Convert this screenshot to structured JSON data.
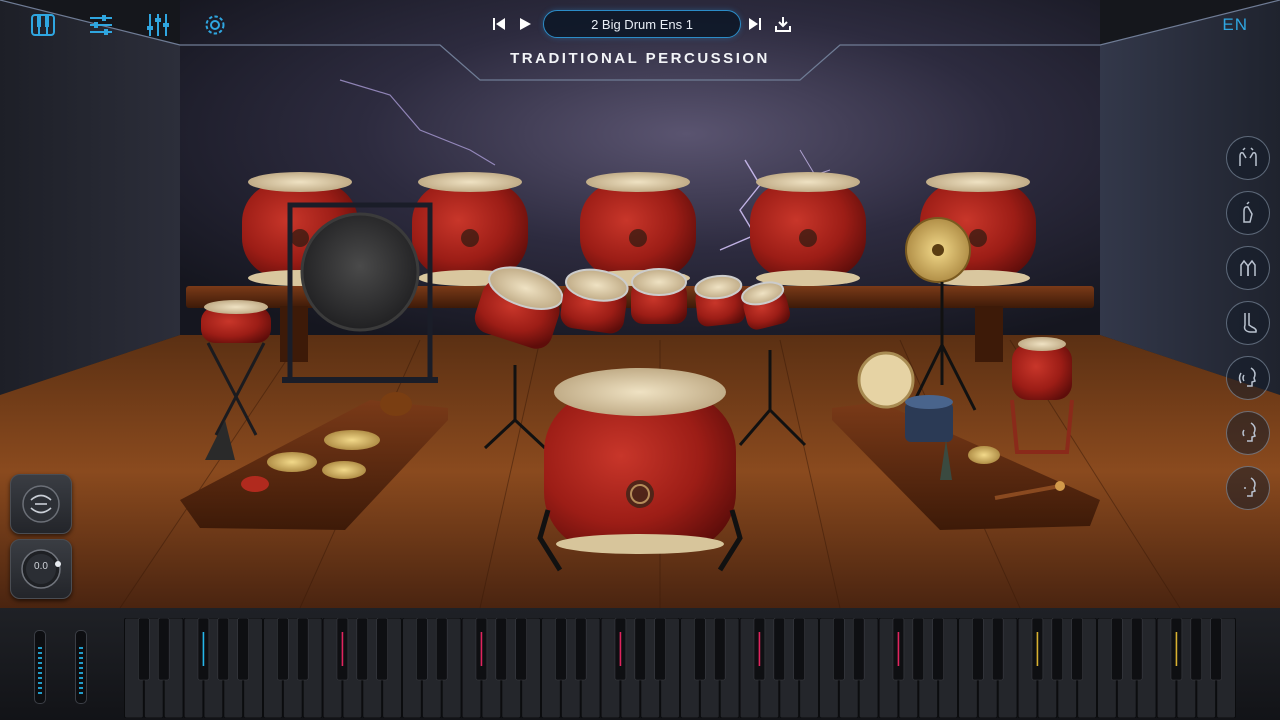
{
  "toolbar": {
    "icons": [
      "keyboard-icon",
      "mixer-icon",
      "equalizer-icon",
      "gear-icon"
    ],
    "accent_color": "#2fa6e0"
  },
  "transport": {
    "preset_name": "2 Big Drum Ens 1",
    "icons": [
      "previous-icon",
      "play-icon",
      "next-icon",
      "download-icon"
    ]
  },
  "instrument_title": "TRADITIONAL PERCUSSION",
  "language": "EN",
  "articulations": [
    "two-hands-icon",
    "single-hand-icon",
    "clap-icon",
    "foot-icon",
    "voice-1-icon",
    "voice-2-icon",
    "voice-3-icon"
  ],
  "controls": {
    "reverb_knob_icon": "rotate-icon",
    "volume_knob_value": "0.0"
  },
  "keyboard": {
    "colored_key_markers": [
      "#25b6ea",
      "#e0245e",
      "#e0245e",
      "#e0245e",
      "#e0245e",
      "#e0245e",
      "#d8b030",
      "#d8b030",
      "#d8b030",
      "#e0245e",
      "#d8b030",
      "#25b6ea"
    ]
  }
}
